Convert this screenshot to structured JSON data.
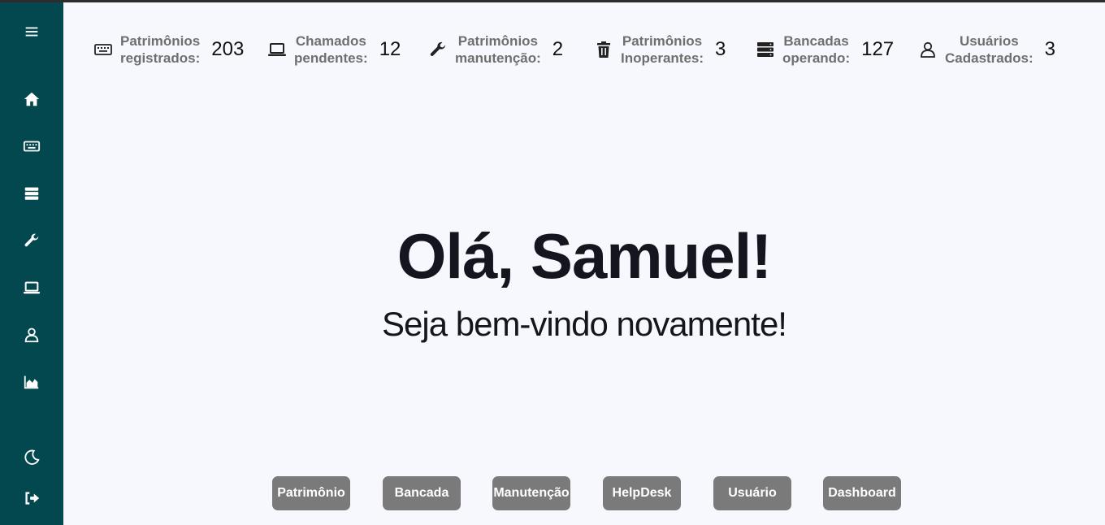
{
  "sidebar": {
    "items": [
      {
        "icon": "menu-icon"
      },
      {
        "icon": "home-icon"
      },
      {
        "icon": "keyboard-icon"
      },
      {
        "icon": "server-icon"
      },
      {
        "icon": "wrench-icon"
      },
      {
        "icon": "laptop-icon"
      },
      {
        "icon": "user-icon"
      },
      {
        "icon": "chart-area-icon"
      },
      {
        "icon": "moon-icon"
      },
      {
        "icon": "logout-icon"
      }
    ],
    "bg_color": "#03484f"
  },
  "stats": [
    {
      "icon": "keyboard-icon",
      "label_line1": "Patrimônios",
      "label_line2": "registrados:",
      "value": "203"
    },
    {
      "icon": "laptop-icon",
      "label_line1": "Chamados",
      "label_line2": "pendentes:",
      "value": "12"
    },
    {
      "icon": "wrench-icon",
      "label_line1": "Patrimônios",
      "label_line2": "manutenção:",
      "value": "2"
    },
    {
      "icon": "trash-icon",
      "label_line1": "Patrimônios",
      "label_line2": "Inoperantes:",
      "value": "3"
    },
    {
      "icon": "server-icon",
      "label_line1": "Bancadas",
      "label_line2": "operando:",
      "value": "127"
    },
    {
      "icon": "user-icon",
      "label_line1": "Usuários",
      "label_line2": "Cadastrados:",
      "value": "3"
    }
  ],
  "welcome": {
    "title": "Olá, Samuel!",
    "subtitle": "Seja bem-vindo novamente!"
  },
  "quick_links": [
    "Patrimônio",
    "Bancada",
    "Manutenção",
    "HelpDesk",
    "Usuário",
    "Dashboard"
  ],
  "colors": {
    "background": "#f7f8fd",
    "button": "#7a7a7a"
  }
}
